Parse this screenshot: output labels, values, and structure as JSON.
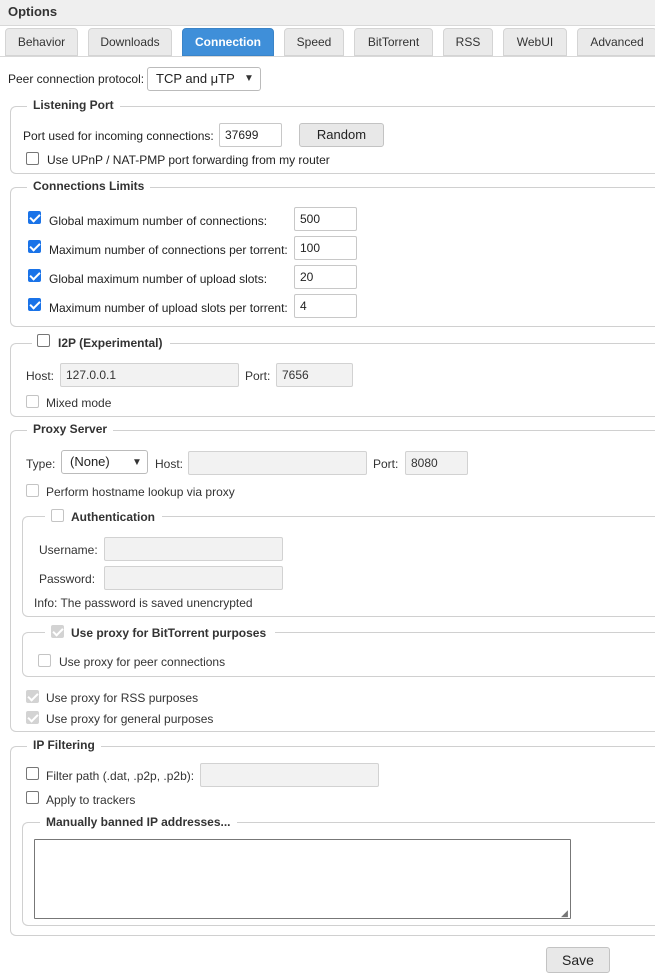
{
  "window": {
    "title": "Options"
  },
  "tabs": [
    {
      "label": "Behavior"
    },
    {
      "label": "Downloads"
    },
    {
      "label": "Connection"
    },
    {
      "label": "Speed"
    },
    {
      "label": "BitTorrent"
    },
    {
      "label": "RSS"
    },
    {
      "label": "WebUI"
    },
    {
      "label": "Advanced"
    }
  ],
  "active_tab": "Connection",
  "protocol": {
    "label": "Peer connection protocol:",
    "value": "TCP and μTP"
  },
  "listening_port": {
    "legend": "Listening Port",
    "port_label": "Port used for incoming connections:",
    "port_value": "37699",
    "random_label": "Random",
    "upnp_label": "Use UPnP / NAT-PMP port forwarding from my router",
    "upnp_checked": false
  },
  "limits": {
    "legend": "Connections Limits",
    "rows": [
      {
        "label": "Global maximum number of connections:",
        "value": "500",
        "checked": true
      },
      {
        "label": "Maximum number of connections per torrent:",
        "value": "100",
        "checked": true
      },
      {
        "label": "Global maximum number of upload slots:",
        "value": "20",
        "checked": true
      },
      {
        "label": "Maximum number of upload slots per torrent:",
        "value": "4",
        "checked": true
      }
    ]
  },
  "i2p": {
    "legend": "I2P (Experimental)",
    "enabled": false,
    "host_label": "Host:",
    "host_value": "127.0.0.1",
    "port_label": "Port:",
    "port_value": "7656",
    "mixed_label": "Mixed mode"
  },
  "proxy": {
    "legend": "Proxy Server",
    "type_label": "Type:",
    "type_value": "(None)",
    "host_label": "Host:",
    "host_value": "",
    "port_label": "Port:",
    "port_value": "8080",
    "hostname_lookup_label": "Perform hostname lookup via proxy",
    "auth": {
      "legend": "Authentication",
      "username_label": "Username:",
      "username_value": "",
      "password_label": "Password:",
      "password_value": "",
      "info": "Info: The password is saved unencrypted"
    },
    "bittorrent": {
      "legend": "Use proxy for BitTorrent purposes",
      "peer_label": "Use proxy for peer connections"
    },
    "rss_label": "Use proxy for RSS purposes",
    "general_label": "Use proxy for general purposes"
  },
  "ip_filtering": {
    "legend": "IP Filtering",
    "filter_label": "Filter path (.dat, .p2p, .p2b):",
    "filter_value": "",
    "trackers_label": "Apply to trackers",
    "banned_legend": "Manually banned IP addresses..."
  },
  "save_label": "Save"
}
